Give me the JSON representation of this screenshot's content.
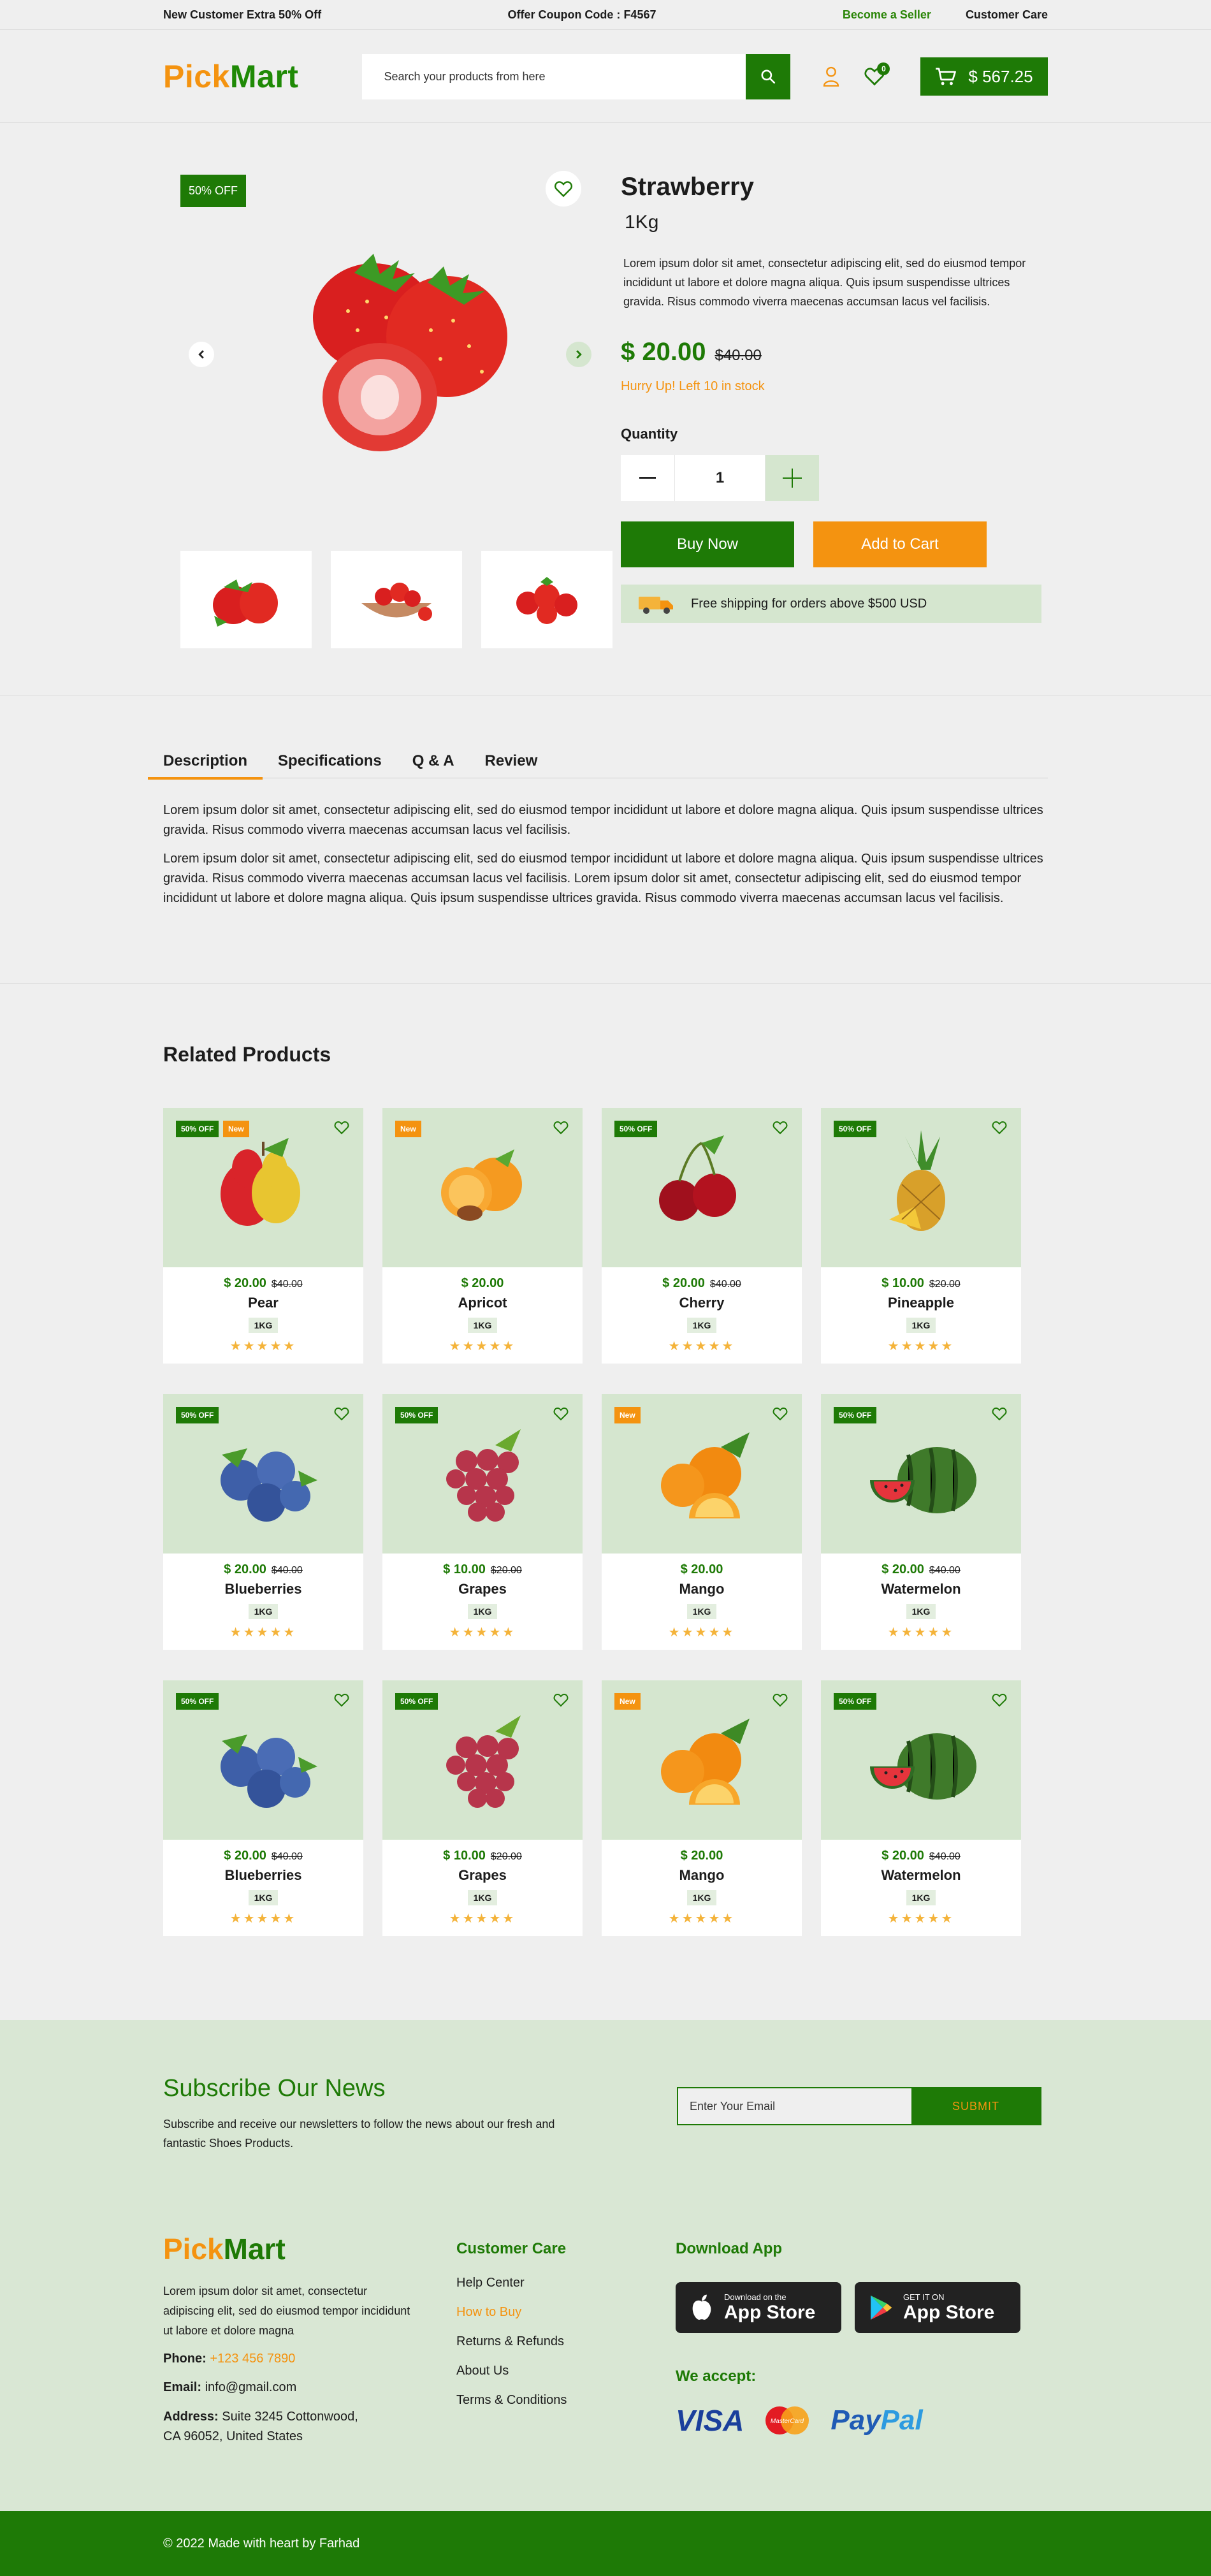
{
  "topbar": {
    "promo": "New Customer Extra 50% Off",
    "coupon_label": "Offer Coupon Code : ",
    "coupon_code": "F4567",
    "become_seller": "Become a Seller",
    "customer_care": "Customer Care"
  },
  "header": {
    "logo_part1": "Pick",
    "logo_part2": "Mart",
    "search_placeholder": "Search your products from here",
    "wishlist_count": "0",
    "cart_total": "$ 567.25"
  },
  "product": {
    "discount_tag": "50% OFF",
    "name": "Strawberry",
    "weight": "1Kg",
    "description": "Lorem ipsum dolor sit amet, consectetur adipiscing elit, sed do eiusmod tempor incididunt ut labore et dolore magna aliqua. Quis ipsum suspendisse ultrices gravida. Risus commodo viverra maecenas accumsan lacus vel facilisis.",
    "price": "$ 20.00",
    "old_price": "$40.00",
    "stock_note": "Hurry Up! Left 10 in stock",
    "quantity_label": "Quantity",
    "quantity": "1",
    "buy_now": "Buy Now",
    "add_to_cart": "Add to Cart",
    "shipping_note": "Free shipping for orders above $500 USD"
  },
  "tabs": {
    "items": [
      "Description",
      "Specifications",
      "Q & A",
      "Review"
    ],
    "active": "Description",
    "paragraph1": "Lorem ipsum dolor sit amet, consectetur adipiscing elit, sed do eiusmod tempor incididunt ut labore et dolore magna aliqua. Quis ipsum suspendisse ultrices gravida. Risus commodo viverra maecenas accumsan lacus vel facilisis.",
    "paragraph2": "Lorem ipsum dolor sit amet, consectetur adipiscing elit, sed do eiusmod tempor incididunt ut labore et dolore magna aliqua. Quis ipsum suspendisse ultrices gravida. Risus commodo viverra maecenas accumsan lacus vel facilisis. Lorem ipsum dolor sit amet, consectetur adipiscing elit, sed do eiusmod tempor incididunt ut labore et dolore magna aliqua. Quis ipsum suspendisse ultrices gravida. Risus commodo viverra maecenas accumsan lacus vel facilisis."
  },
  "related": {
    "title": "Related Products",
    "products": [
      {
        "name": "Pear",
        "price": "$ 20.00",
        "old": "$40.00",
        "unit": "1KG",
        "off": "50% OFF",
        "new": "New",
        "fruit": "pear"
      },
      {
        "name": "Apricot",
        "price": "$ 20.00",
        "old": "",
        "unit": "1KG",
        "off": "",
        "new": "New",
        "fruit": "apricot"
      },
      {
        "name": "Cherry",
        "price": "$ 20.00",
        "old": "$40.00",
        "unit": "1KG",
        "off": "50% OFF",
        "new": "",
        "fruit": "cherry"
      },
      {
        "name": "Pineapple",
        "price": "$ 10.00",
        "old": "$20.00",
        "unit": "1KG",
        "off": "50% OFF",
        "new": "",
        "fruit": "pineapple"
      },
      {
        "name": "Blueberries",
        "price": "$ 20.00",
        "old": "$40.00",
        "unit": "1KG",
        "off": "50% OFF",
        "new": "",
        "fruit": "blueberry"
      },
      {
        "name": "Grapes",
        "price": "$ 10.00",
        "old": "$20.00",
        "unit": "1KG",
        "off": "50% OFF",
        "new": "",
        "fruit": "grapes"
      },
      {
        "name": "Mango",
        "price": "$ 20.00",
        "old": "",
        "unit": "1KG",
        "off": "",
        "new": "New",
        "fruit": "orange"
      },
      {
        "name": "Watermelon",
        "price": "$ 20.00",
        "old": "$40.00",
        "unit": "1KG",
        "off": "50% OFF",
        "new": "",
        "fruit": "watermelon"
      },
      {
        "name": "Blueberries",
        "price": "$ 20.00",
        "old": "$40.00",
        "unit": "1KG",
        "off": "50% OFF",
        "new": "",
        "fruit": "blueberry"
      },
      {
        "name": "Grapes",
        "price": "$ 10.00",
        "old": "$20.00",
        "unit": "1KG",
        "off": "50% OFF",
        "new": "",
        "fruit": "grapes"
      },
      {
        "name": "Mango",
        "price": "$ 20.00",
        "old": "",
        "unit": "1KG",
        "off": "",
        "new": "New",
        "fruit": "orange"
      },
      {
        "name": "Watermelon",
        "price": "$ 20.00",
        "old": "$40.00",
        "unit": "1KG",
        "off": "50% OFF",
        "new": "",
        "fruit": "watermelon"
      }
    ]
  },
  "subscribe": {
    "title": "Subscribe Our News",
    "text": "Subscribe and receive our newsletters to follow the news about our fresh and fantastic Shoes Products.",
    "email_placeholder": "Enter Your Email",
    "submit": "SUBMIT"
  },
  "footer": {
    "description": "Lorem ipsum dolor sit amet, consectetur adipiscing elit, sed do eiusmod tempor incididunt ut labore et dolore magna",
    "phone_label": "Phone:",
    "phone": "+123 456 7890",
    "email_label": "Email:",
    "email": "info@gmail.com",
    "address_label": "Address:",
    "address_line1": "Suite 3245 Cottonwood,",
    "address_line2": "CA 96052, United States",
    "care_title": "Customer Care",
    "care_links": [
      "Help Center",
      "How to Buy",
      "Returns & Refunds",
      "About Us",
      "Terms & Conditions"
    ],
    "download_title": "Download App",
    "appstore_small": "Download on the",
    "appstore_big": "App Store",
    "play_small": "GET IT ON",
    "play_big": "App Store",
    "accept_title": "We accept:",
    "visa": "VISA",
    "mastercard": "MasterCard",
    "paypal_a": "Pay",
    "paypal_b": "Pal",
    "copyright": "© 2022 Made with heart by Farhad"
  },
  "colors": {
    "brand_green": "#1e7a06",
    "accent_orange": "#f49310",
    "soft_green": "#d5e6cf"
  }
}
